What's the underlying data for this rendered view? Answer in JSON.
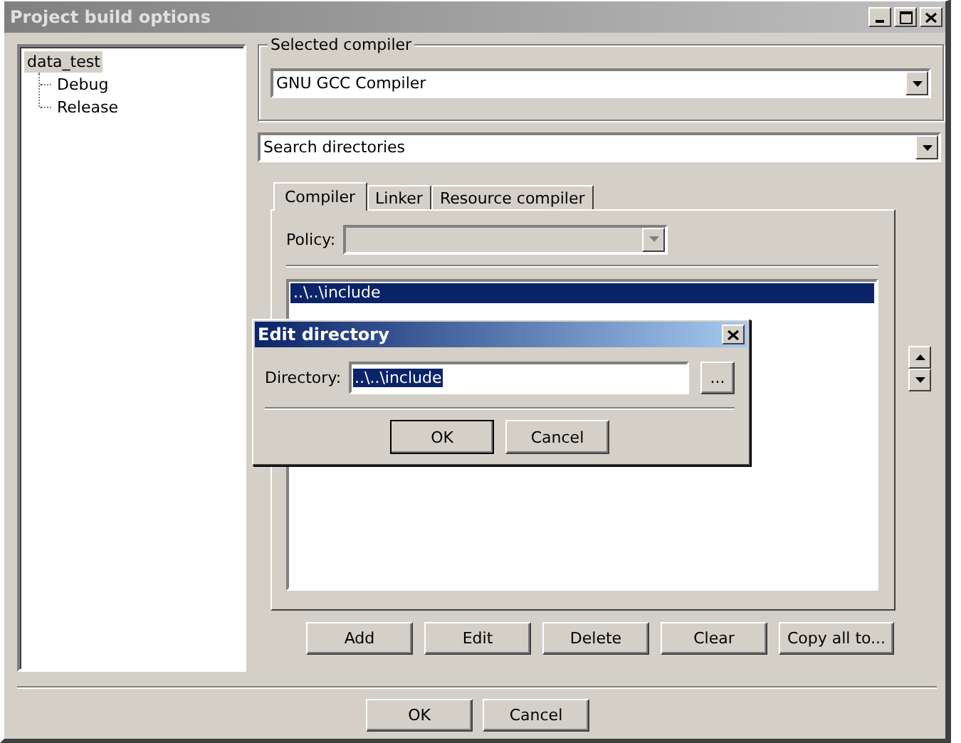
{
  "window": {
    "title": "Project build options"
  },
  "tree": [
    {
      "label": "data_test",
      "selected": true,
      "children": [
        {
          "label": "Debug",
          "selected": false
        },
        {
          "label": "Release",
          "selected": false
        }
      ]
    }
  ],
  "compiler_group": {
    "label": "Selected compiler",
    "value": "GNU GCC Compiler"
  },
  "section_dropdown": {
    "value": "Search directories"
  },
  "tabs": [
    {
      "label": "Compiler",
      "selected": true
    },
    {
      "label": "Linker",
      "selected": false
    },
    {
      "label": "Resource compiler",
      "selected": false
    }
  ],
  "policy": {
    "label": "Policy:",
    "disabled": true
  },
  "directories": [
    {
      "path": "..\\..\\include",
      "selected": true
    }
  ],
  "list_buttons": [
    "Add",
    "Edit",
    "Delete",
    "Clear",
    "Copy all to..."
  ],
  "dialog_buttons": [
    "OK",
    "Cancel"
  ],
  "edit_dialog": {
    "title": "Edit directory",
    "label": "Directory:",
    "value": "..\\..\\include",
    "text_selected": true,
    "browse": "...",
    "buttons": [
      "OK",
      "Cancel"
    ]
  }
}
